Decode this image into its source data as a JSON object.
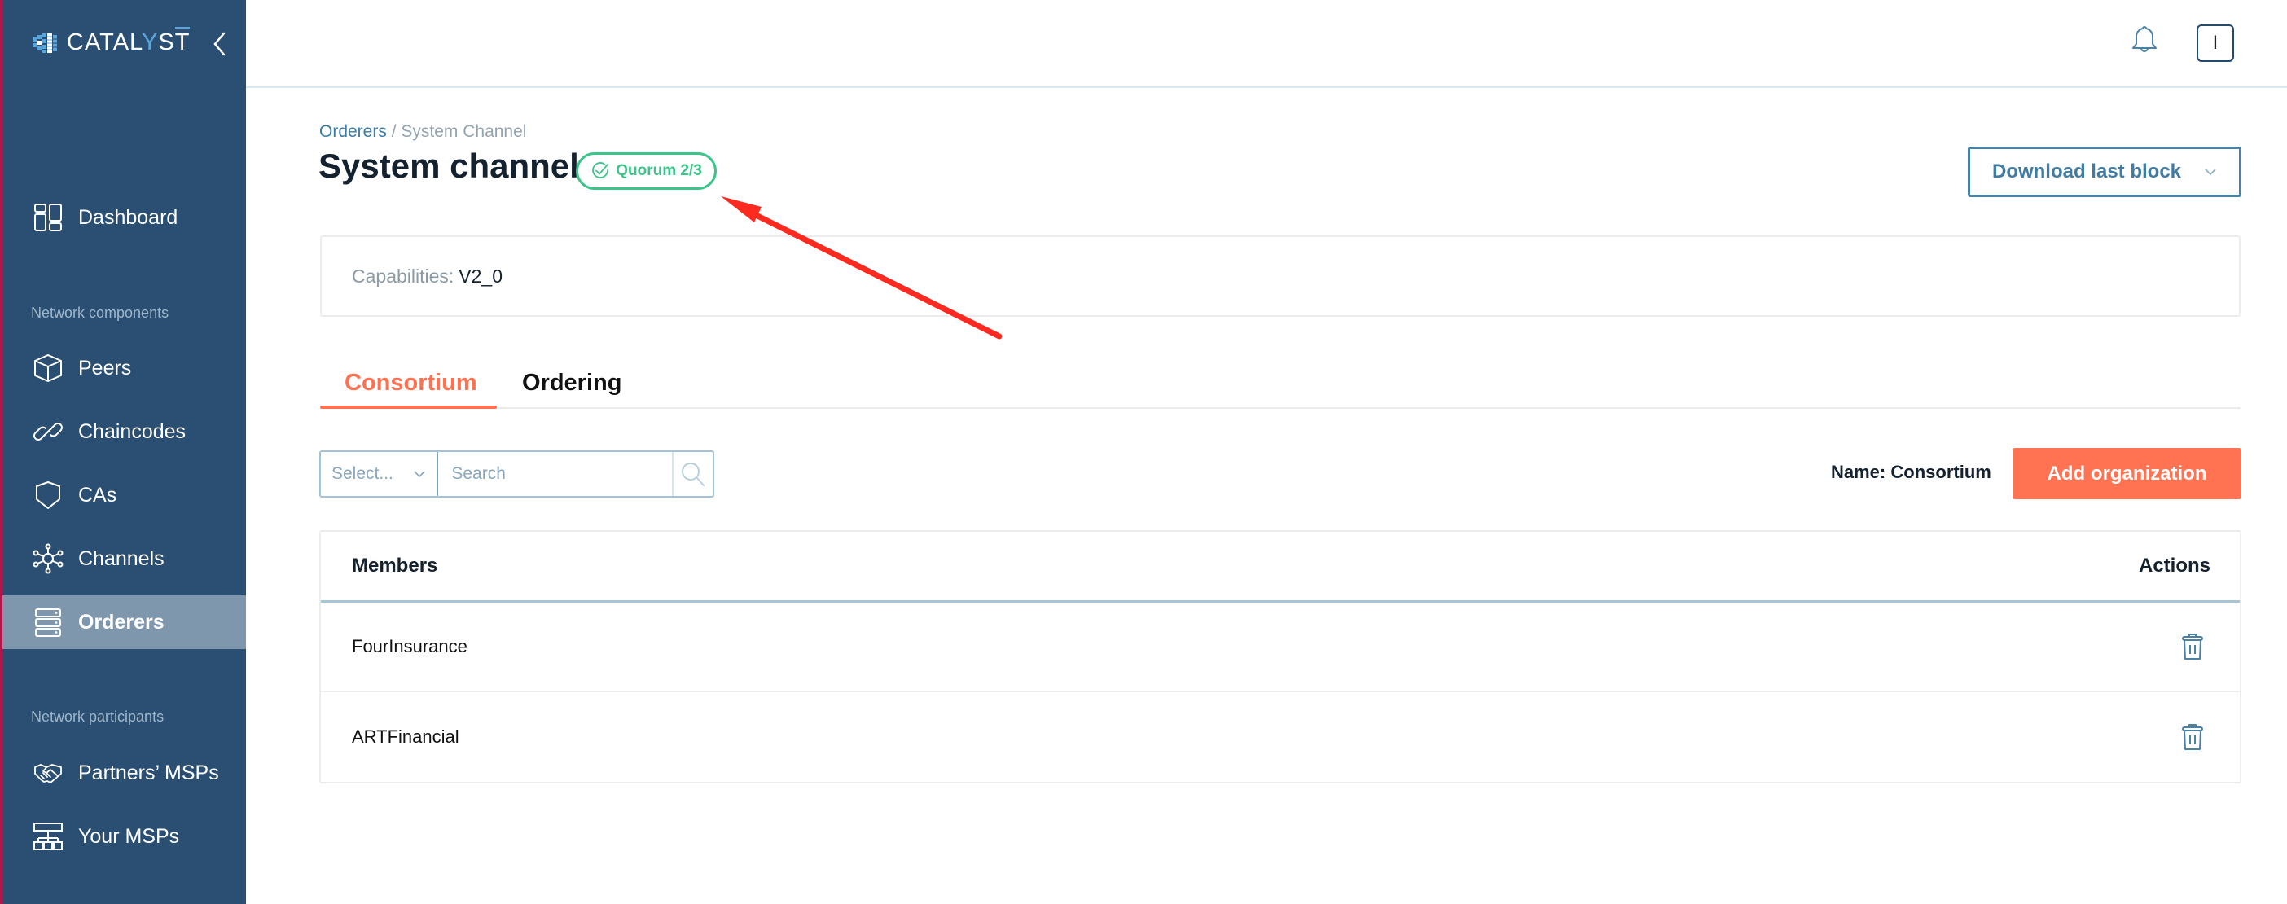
{
  "app": {
    "brand": {
      "prefix": "CATAL",
      "y": "Y",
      "s": "S",
      "t": "T"
    },
    "collapse_icon": "chevron-left-icon"
  },
  "sidebar": {
    "items": [
      {
        "label": "Dashboard",
        "icon": "dashboard-icon"
      },
      {
        "label": "Peers",
        "icon": "cube-icon"
      },
      {
        "label": "Chaincodes",
        "icon": "link-icon"
      },
      {
        "label": "CAs",
        "icon": "shield-icon"
      },
      {
        "label": "Channels",
        "icon": "network-hub-icon"
      },
      {
        "label": "Orderers",
        "icon": "server-stack-icon",
        "active": true
      },
      {
        "label": "Partners’ MSPs",
        "icon": "handshake-icon"
      },
      {
        "label": "Your MSPs",
        "icon": "org-chart-icon"
      }
    ],
    "sections": {
      "components": "Network components",
      "participants": "Network participants"
    }
  },
  "header": {
    "notifications_icon": "bell-icon",
    "avatar_initial": "I"
  },
  "page": {
    "breadcrumb": {
      "parent": "Orderers",
      "separator": " / ",
      "current": "System Channel"
    },
    "title": "System channel",
    "quorum_badge": "Quorum 2/3",
    "download_button": "Download last block",
    "capabilities_label": "Capabilities:",
    "capabilities_value": "V2_0",
    "tabs": [
      {
        "label": "Consortium",
        "active": true
      },
      {
        "label": "Ordering",
        "active": false
      }
    ],
    "filter": {
      "select_placeholder": "Select...",
      "search_placeholder": "Search"
    },
    "name_label": "Name:",
    "name_value": "Consortium",
    "add_button": "Add organization",
    "table": {
      "columns": [
        "Members",
        "Actions"
      ],
      "rows": [
        {
          "member": "FourInsurance"
        },
        {
          "member": "ARTFinancial"
        }
      ]
    }
  },
  "colors": {
    "sidebar": "#2b4f72",
    "sidebar_active": "#7f97ad",
    "accent": "#ff7352",
    "success": "#3cc48a",
    "link": "#3c7ba6",
    "annotation_arrow": "#ff2a1f"
  }
}
